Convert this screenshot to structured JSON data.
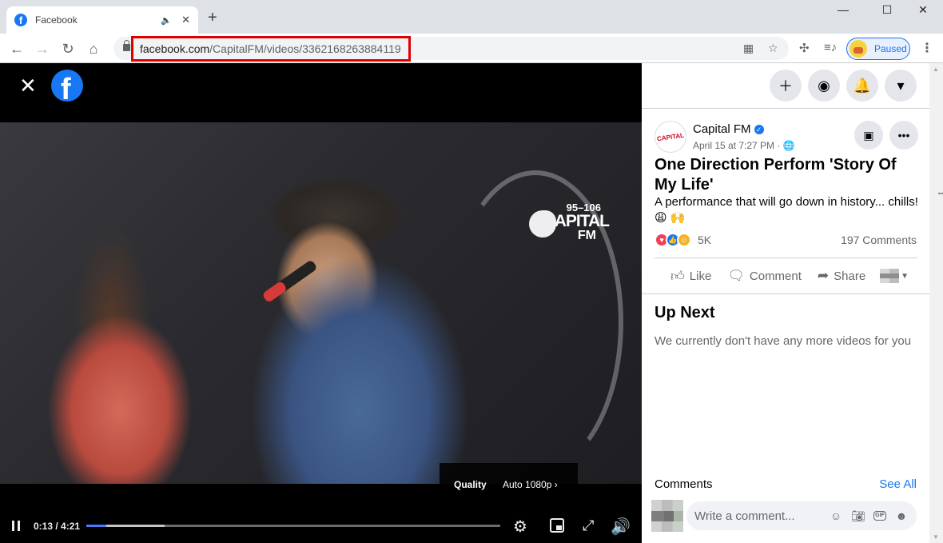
{
  "browser": {
    "tab": {
      "title": "Facebook",
      "favicon": "facebook-icon"
    },
    "new_tab_label": "+",
    "window_controls": {
      "minimize": "—",
      "maximize": "☐",
      "close": "✕"
    },
    "url_host": "facebook.com",
    "url_path": "/CapitalFM/videos/3362168263884119",
    "profile_label": "Paused",
    "highlight_color": "#e00000"
  },
  "video": {
    "close_icon": "✕",
    "overlay_logo": {
      "freq": "95–106",
      "name": "CAPITAL",
      "suffix": "FM"
    },
    "quality": {
      "label": "Quality",
      "value": "Auto 1080p ›"
    },
    "time_display": "0:13 / 4:21",
    "progress": {
      "played_fraction": 0.048,
      "buffered_fraction": 0.19
    }
  },
  "side": {
    "page_name": "Capital FM",
    "page_avatar_text": "CAPITAL",
    "post_meta": "April 15 at 7:27 PM · 🌐",
    "post_title": "One Direction Perform 'Story Of My Life'",
    "post_description": "A performance that will go down in history... chills! 😩 🙌",
    "reaction_count": "5K",
    "comment_count": "197 Comments",
    "actions": {
      "like": "Like",
      "comment": "Comment",
      "share": "Share"
    },
    "up_next": {
      "title": "Up Next",
      "empty": "We currently don't have any more videos for you"
    },
    "comments": {
      "label": "Comments",
      "see_all": "See All",
      "placeholder": "Write a comment..."
    }
  }
}
